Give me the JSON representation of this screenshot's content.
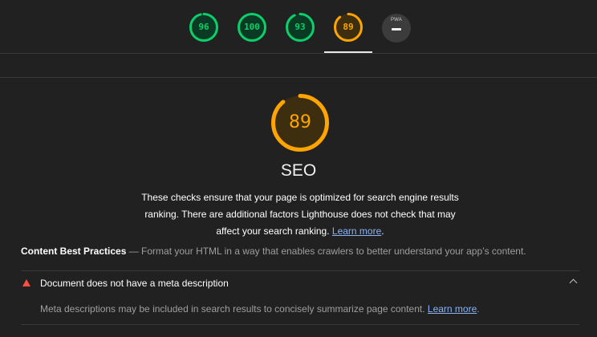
{
  "scores": [
    {
      "value": "96",
      "fraction": 0.96,
      "color": "#0cce6b",
      "track": "#0b3a24",
      "name": "performance"
    },
    {
      "value": "100",
      "fraction": 1.0,
      "color": "#0cce6b",
      "track": "#0b3a24",
      "name": "accessibility"
    },
    {
      "value": "93",
      "fraction": 0.93,
      "color": "#0cce6b",
      "track": "#0b3a24",
      "name": "best-practices"
    },
    {
      "value": "89",
      "fraction": 0.89,
      "color": "#ffa400",
      "track": "#3d2e10",
      "name": "seo"
    }
  ],
  "pwa": {
    "label": "PWA"
  },
  "category": {
    "score": "89",
    "fraction": 0.89,
    "title": "SEO",
    "description": "These checks ensure that your page is optimized for search engine results ranking. There are additional factors Lighthouse does not check that may affect your search ranking. ",
    "learn_more": "Learn more",
    "period": "."
  },
  "group": {
    "title": "Content Best Practices",
    "separator": " — ",
    "description": "Format your HTML in a way that enables crawlers to better understand your app’s content."
  },
  "audit": {
    "title": "Document does not have a meta description",
    "description": "Meta descriptions may be included in search results to concisely summarize page content. ",
    "learn_more": "Learn more",
    "period": "."
  },
  "colors": {
    "pass": "#0cce6b",
    "average": "#ffa400",
    "fail": "#ff4e42",
    "link": "#8ab4f8"
  }
}
